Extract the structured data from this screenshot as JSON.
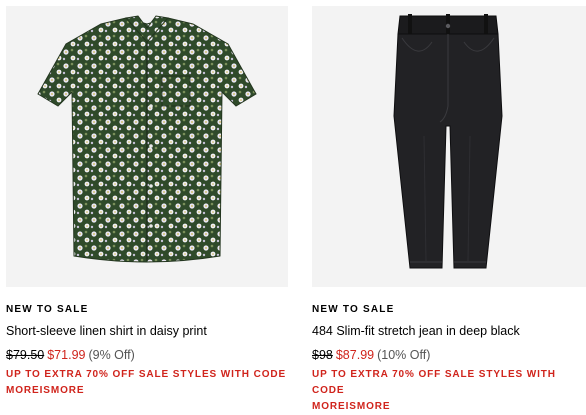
{
  "products": [
    {
      "image_alt": "Short-sleeve linen shirt in daisy print",
      "badge": "NEW TO SALE",
      "title": "Short-sleeve linen shirt in daisy print",
      "original_price": "$79.50",
      "sale_price": "$71.99",
      "discount": "(9% Off)",
      "promo_line1": "UP TO EXTRA 70% OFF SALE STYLES WITH CODE",
      "promo_line2": "MOREISMORE"
    },
    {
      "image_alt": "484 Slim-fit stretch jean in deep black",
      "badge": "NEW TO SALE",
      "title": "484 Slim-fit stretch jean in deep black",
      "original_price": "$98",
      "sale_price": "$87.99",
      "discount": "(10% Off)",
      "promo_line1": "UP TO EXTRA 70% OFF SALE STYLES WITH CODE",
      "promo_line2": "MOREISMORE"
    }
  ],
  "colors": {
    "sale_red": "#d0241c",
    "image_bg": "#f3f3f3"
  }
}
